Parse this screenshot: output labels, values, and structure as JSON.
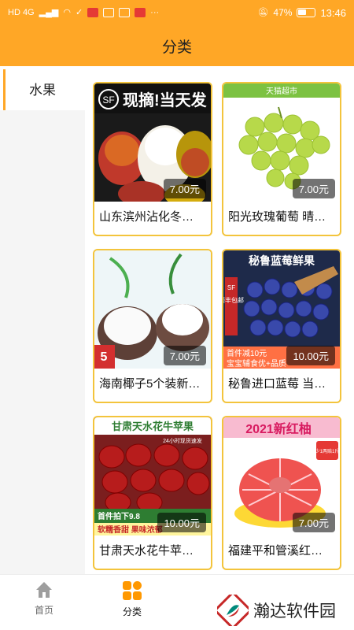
{
  "status_bar": {
    "left_text": "HD 4G",
    "battery_percent": "47%",
    "time": "13:46"
  },
  "header": {
    "title": "分类"
  },
  "sidebar": {
    "items": [
      {
        "label": "水果",
        "active": true
      }
    ]
  },
  "products": [
    {
      "title": "山东滨州沾化冬…",
      "price": "7.00元",
      "image_banner": "现摘!当天发",
      "image_badge": "SF",
      "image": "winter-jujube-icon"
    },
    {
      "title": "阳光玫瑰葡萄 晴…",
      "price": "7.00元",
      "image_banner": "天猫超市",
      "image": "green-grapes-icon"
    },
    {
      "title": "海南椰子5个装新…",
      "price": "7.00元",
      "image_badge": "5",
      "image": "coconut-icon"
    },
    {
      "title": "秘鲁进口蓝莓 当…",
      "price": "10.00元",
      "image_banner": "秘鲁蓝莓鲜果",
      "image_badge": "SF",
      "image_badge_text": "顺丰包邮",
      "image_footer": "首件减10元",
      "image_footer2": "宝宝辅食优+品质",
      "image": "blueberries-icon"
    },
    {
      "title": "甘肃天水花牛苹…",
      "price": "10.00元",
      "image_banner": "甘肃天水花牛苹果",
      "image_sub": "24小时现货速发",
      "image_footer": "首件拍下9.8",
      "image_footer2": "软糯香甜 果味浓郁",
      "image": "red-apples-icon"
    },
    {
      "title": "福建平和管溪红…",
      "price": "7.00元",
      "image_banner": "2021新红柚",
      "image_badge_text": "少1两赔1斤",
      "image": "red-pomelo-icon"
    }
  ],
  "tabbar": {
    "items": [
      {
        "label": "首页",
        "icon": "home-icon",
        "active": false
      },
      {
        "label": "分类",
        "icon": "category-grid-icon",
        "active": true
      }
    ]
  },
  "watermark": {
    "text": "瀚达软件园",
    "icon": "brand-logo-icon"
  },
  "colors": {
    "accent": "#FFA726",
    "card_border": "#f3c43c",
    "price_bg": "#00000088"
  }
}
